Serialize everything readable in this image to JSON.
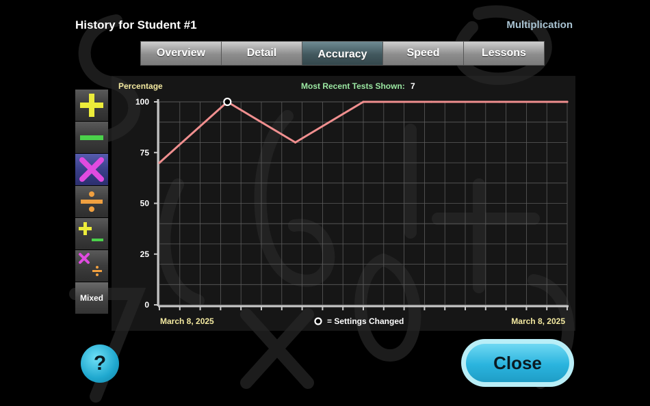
{
  "header": {
    "title": "History for Student #1",
    "subject": "Multiplication"
  },
  "tabs": [
    {
      "label": "Overview",
      "active": false
    },
    {
      "label": "Detail",
      "active": false
    },
    {
      "label": "Accuracy",
      "active": true
    },
    {
      "label": "Speed",
      "active": false
    },
    {
      "label": "Lessons",
      "active": false
    }
  ],
  "operations": [
    {
      "name": "addition",
      "icon": "plus-icon"
    },
    {
      "name": "subtraction",
      "icon": "minus-icon"
    },
    {
      "name": "multiplication",
      "icon": "times-icon",
      "active": true
    },
    {
      "name": "division",
      "icon": "divide-icon"
    },
    {
      "name": "add-subtract",
      "icon": "plus-minus-icon"
    },
    {
      "name": "multiply-divide",
      "icon": "times-divide-icon"
    },
    {
      "name": "mixed",
      "label": "Mixed"
    }
  ],
  "chart_header": {
    "ylabel": "Percentage",
    "recent_label": "Most Recent Tests Shown:",
    "recent_count": "7"
  },
  "chart_footer": {
    "start_date": "March 8, 2025",
    "end_date": "March 8, 2025",
    "legend_text": "= Settings Changed"
  },
  "chart_data": {
    "type": "line",
    "title": "",
    "xlabel": "",
    "ylabel": "Percentage",
    "ylim": [
      0,
      100
    ],
    "yticks": [
      "100",
      "75",
      "50",
      "25",
      "0"
    ],
    "x": [
      1,
      2,
      3,
      4,
      5,
      6,
      7
    ],
    "series": [
      {
        "values": [
          70,
          100,
          80,
          100,
          100,
          100,
          100
        ]
      }
    ],
    "settings_changed_points": [
      2
    ],
    "grid": true
  },
  "buttons": {
    "help": "?",
    "close": "Close"
  },
  "colors": {
    "line": "#f08f8f",
    "accent_blue": "#2ab4de",
    "date_yellow": "#f3e9a0",
    "label_green": "#9be7a2",
    "ylabel_yellow": "#f3e9a0"
  }
}
